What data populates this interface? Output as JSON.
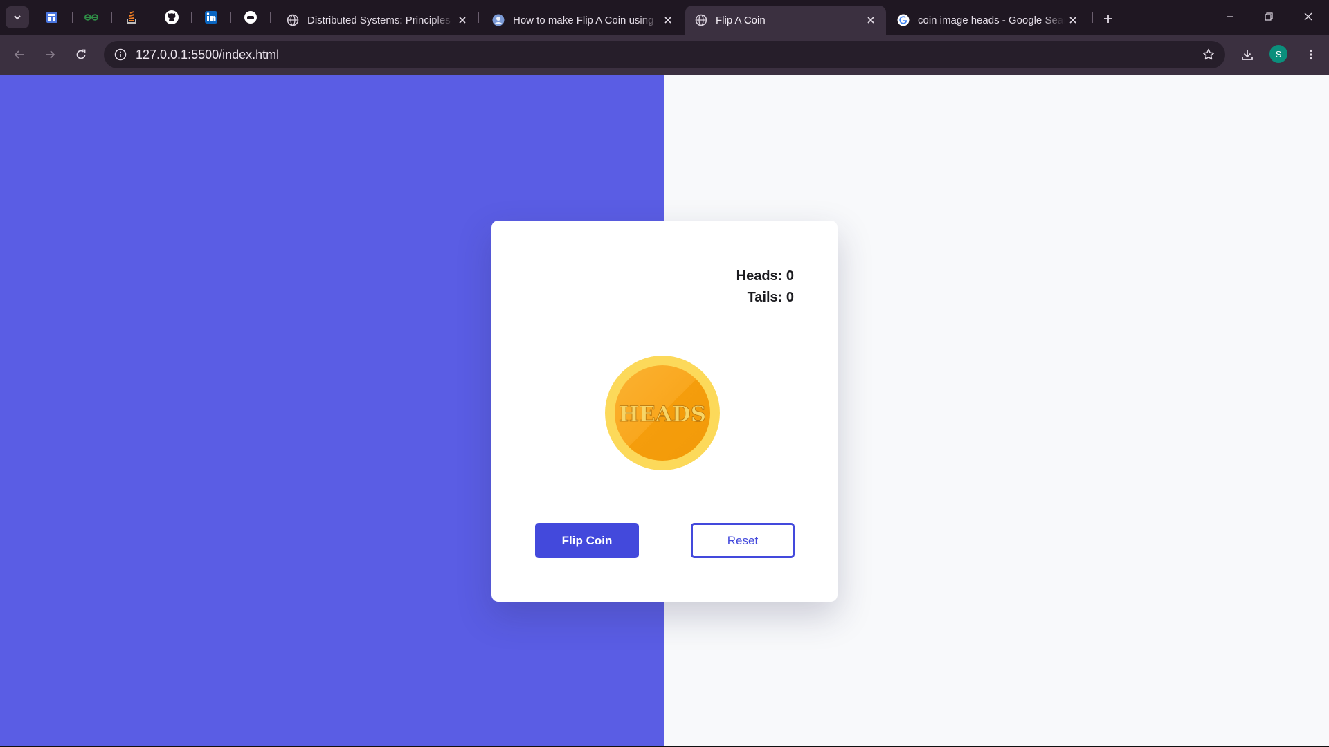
{
  "browser": {
    "tabs": [
      {
        "title": "Distributed Systems: Principles and",
        "favicon": "globe-icon"
      },
      {
        "title": "How to make Flip A Coin using",
        "favicon": "site-avatar-icon"
      },
      {
        "title": "Flip A Coin",
        "favicon": "globe-icon",
        "active": true
      },
      {
        "title": "coin image heads - Google Search",
        "favicon": "google-g-icon"
      }
    ],
    "pinned_favicons": [
      "dashboard-icon",
      "geeksforgeeks-icon",
      "stackoverflow-icon",
      "github-icon",
      "linkedin-icon",
      "chat-icon"
    ],
    "url": "127.0.0.1:5500/index.html",
    "profile_initial": "S",
    "colors": {
      "tabbar": "#1f1722",
      "toolbar": "#3b3040",
      "omnibox": "#261e2a",
      "profile": "#0b8f7c"
    }
  },
  "app": {
    "heads_label": "Heads: 0",
    "tails_label": "Tails: 0",
    "coin_text": "HEADS",
    "flip_button": "Flip Coin",
    "reset_button": "Reset",
    "colors": {
      "left_bg": "#5a5de4",
      "right_bg": "#f8f9fb",
      "accent": "#4349dc",
      "coin_outer": "#fcd95a",
      "coin_inner": "#f9a31a"
    }
  }
}
